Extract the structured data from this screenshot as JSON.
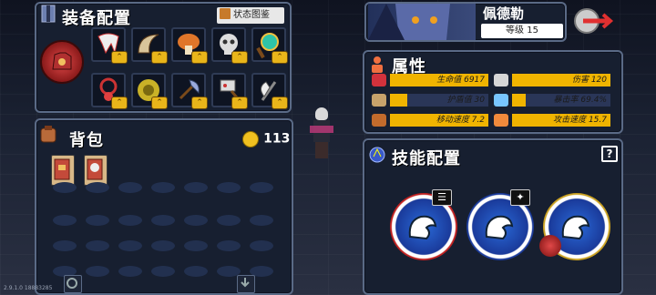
{
  "equipment": {
    "title": "装备配置",
    "status_button": "状态图鉴"
  },
  "bag": {
    "title": "背包",
    "coins": "113"
  },
  "hero": {
    "name": "佩德勒",
    "level_label": "等级 15"
  },
  "attributes": {
    "title": "属性",
    "left": [
      {
        "label": "生命值 6917",
        "fill": 1.0,
        "icon": "heart-icon",
        "color": "#d2323c"
      },
      {
        "label": "护盾值 30",
        "fill": 0.18,
        "icon": "shield-icon",
        "color": "#c7a36b"
      },
      {
        "label": "移动速度 7.2",
        "fill": 1.0,
        "icon": "boot-icon",
        "color": "#c26b2c"
      }
    ],
    "right": [
      {
        "label": "伤害 120",
        "fill": 1.0,
        "icon": "sword-icon",
        "color": "#d6d6d6"
      },
      {
        "label": "暴击率 69.4%",
        "fill": 0.14,
        "icon": "eye-icon",
        "color": "#78c6ff"
      },
      {
        "label": "攻击速度 15.7",
        "fill": 1.0,
        "icon": "fire-icon",
        "color": "#f08a3c"
      }
    ]
  },
  "skills": {
    "title": "技能配置",
    "help": "?"
  },
  "version": "2.9.1.0 18883285",
  "colors": {
    "accent": "#f0b400",
    "panel_border": "#5a6a86",
    "panel_bg": "#171f30"
  }
}
